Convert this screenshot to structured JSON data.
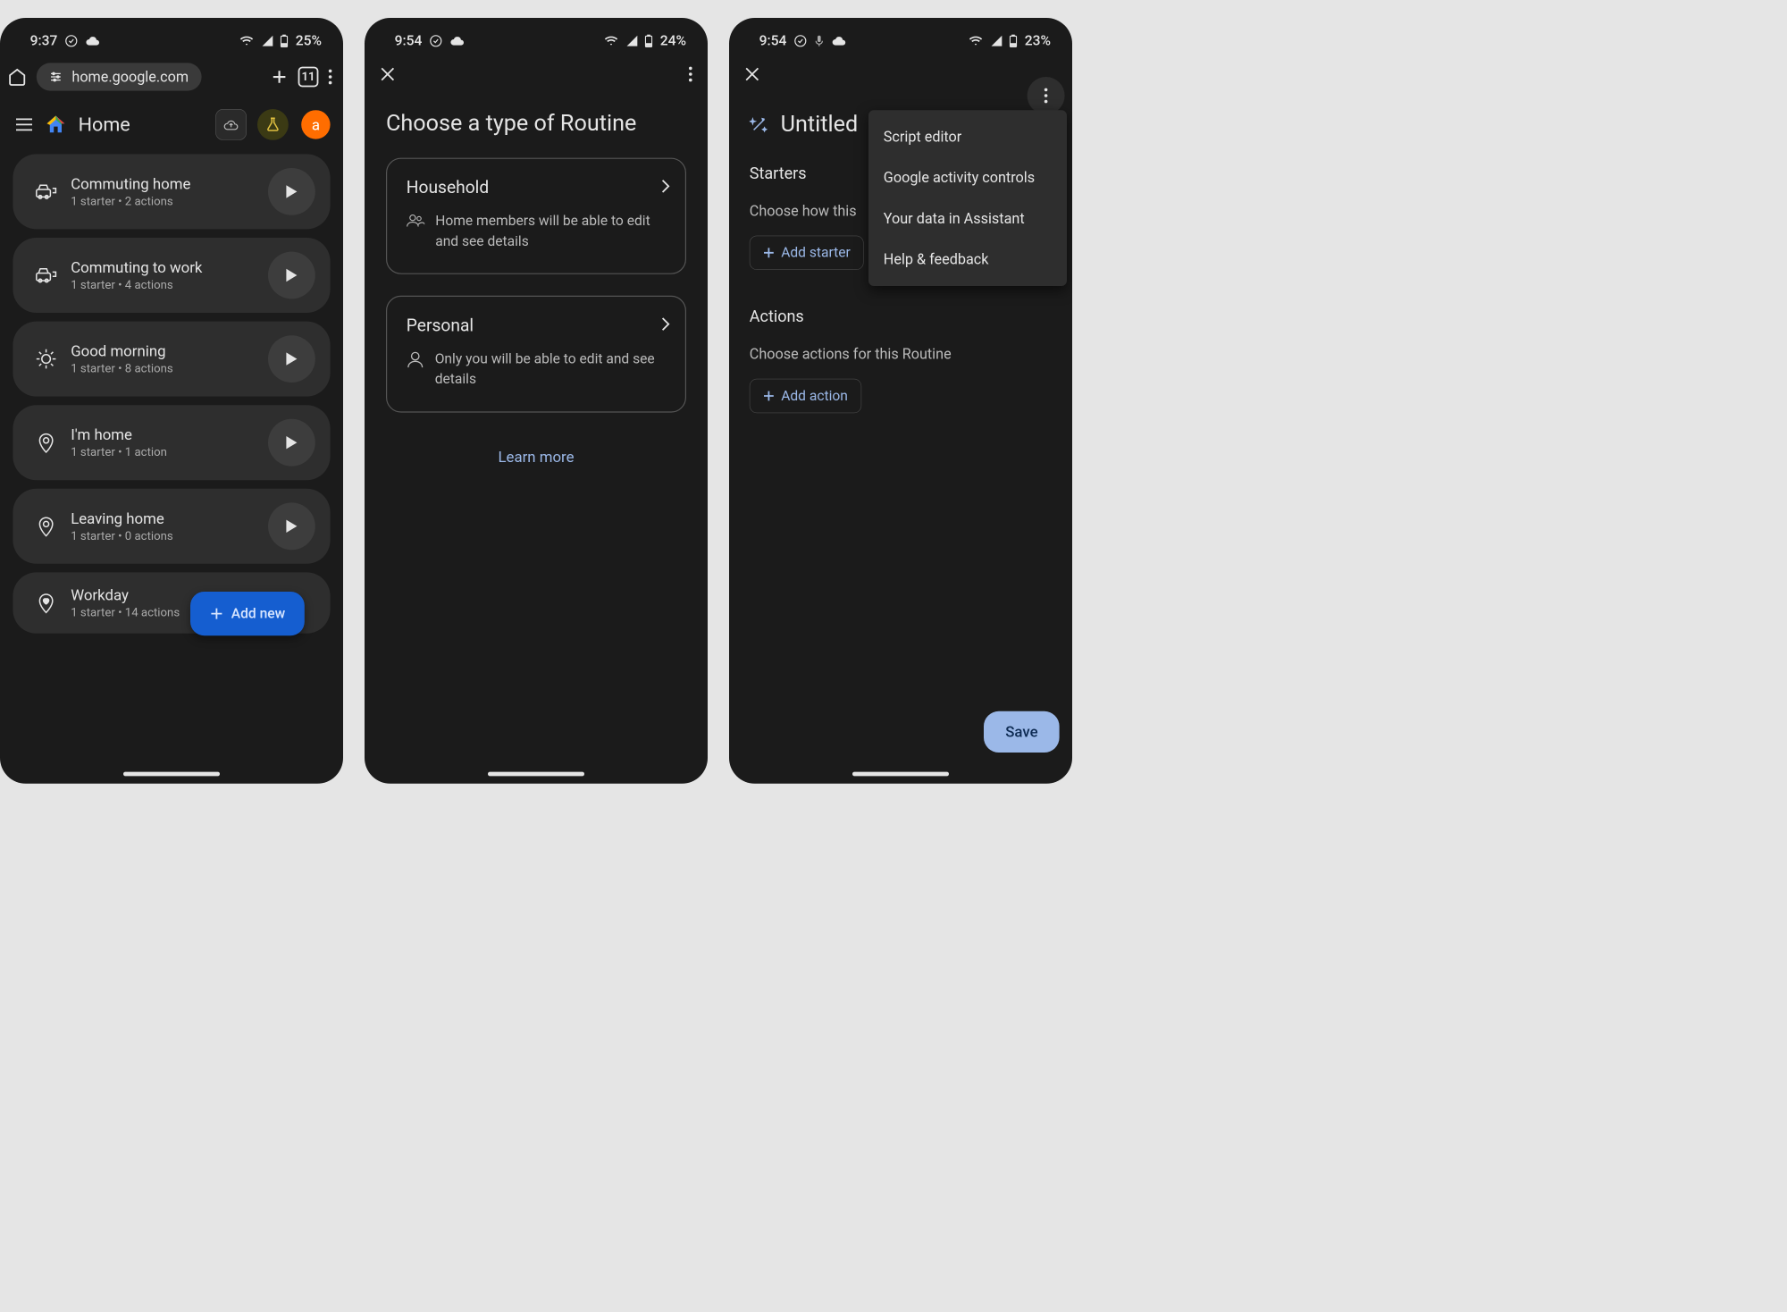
{
  "phone1": {
    "status": {
      "time": "9:37",
      "battery": "25%"
    },
    "url": "home.google.com",
    "tab_count": "11",
    "app_title": "Home",
    "avatar_letter": "a",
    "routines": [
      {
        "icon": "car",
        "title": "Commuting home",
        "sub": "1 starter • 2 actions"
      },
      {
        "icon": "car",
        "title": "Commuting to work",
        "sub": "1 starter • 4 actions"
      },
      {
        "icon": "sun",
        "title": "Good morning",
        "sub": "1 starter • 8 actions"
      },
      {
        "icon": "pin",
        "title": "I'm home",
        "sub": "1 starter • 1 action"
      },
      {
        "icon": "pin",
        "title": "Leaving home",
        "sub": "1 starter • 0 actions"
      },
      {
        "icon": "heart-pin",
        "title": "Workday",
        "sub": "1 starter • 14 actions"
      }
    ],
    "fab_label": "Add new"
  },
  "phone2": {
    "status": {
      "time": "9:54",
      "battery": "24%"
    },
    "screen_title": "Choose a type of Routine",
    "card1": {
      "title": "Household",
      "desc": "Home members will be able to edit and see details"
    },
    "card2": {
      "title": "Personal",
      "desc": "Only you will be able to edit and see details"
    },
    "learn_more": "Learn more"
  },
  "phone3": {
    "status": {
      "time": "9:54",
      "battery": "23%"
    },
    "title": "Untitled",
    "starters_heading": "Starters",
    "starters_sub": "Choose how this",
    "add_starter": "Add starter",
    "actions_heading": "Actions",
    "actions_sub": "Choose actions for this Routine",
    "add_action": "Add action",
    "menu": [
      "Script editor",
      "Google activity controls",
      "Your data in Assistant",
      "Help & feedback"
    ],
    "save": "Save"
  }
}
